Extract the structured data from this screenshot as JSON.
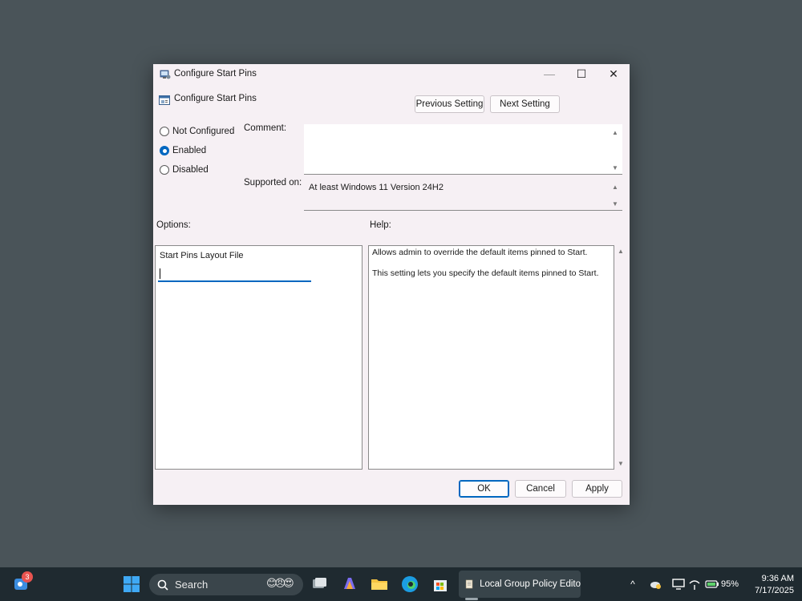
{
  "window": {
    "title": "Configure Start Pins",
    "controls": {
      "minimize": "—",
      "maximize": "☐",
      "close": "✕"
    }
  },
  "policy": {
    "name": "Configure Start Pins",
    "prev_button": "Previous Setting",
    "next_button": "Next Setting"
  },
  "state": {
    "options": [
      {
        "label": "Not Configured",
        "checked": false
      },
      {
        "label": "Enabled",
        "checked": true
      },
      {
        "label": "Disabled",
        "checked": false
      }
    ]
  },
  "comment": {
    "label": "Comment:",
    "value": ""
  },
  "supported": {
    "label": "Supported on:",
    "value": "At least Windows 11 Version 24H2"
  },
  "options_panel": {
    "label": "Options:",
    "field_label": "Start Pins Layout File",
    "field_value": ""
  },
  "help_panel": {
    "label": "Help:",
    "lines": [
      "Allows admin to override the default items pinned to Start.",
      "This setting lets you specify the default items pinned to Start."
    ]
  },
  "footer": {
    "ok": "OK",
    "cancel": "Cancel",
    "apply": "Apply"
  },
  "taskbar": {
    "widget_badge": "3",
    "search_label": "Search",
    "active_app": "Local Group Policy Edito",
    "battery": "95%",
    "time": "9:36 AM",
    "date": "7/17/2025"
  },
  "colors": {
    "accent": "#0067c0",
    "dialog_bg": "#f6f0f4",
    "taskbar_bg": "#1f2a30",
    "desktop_bg": "#4a5459"
  }
}
